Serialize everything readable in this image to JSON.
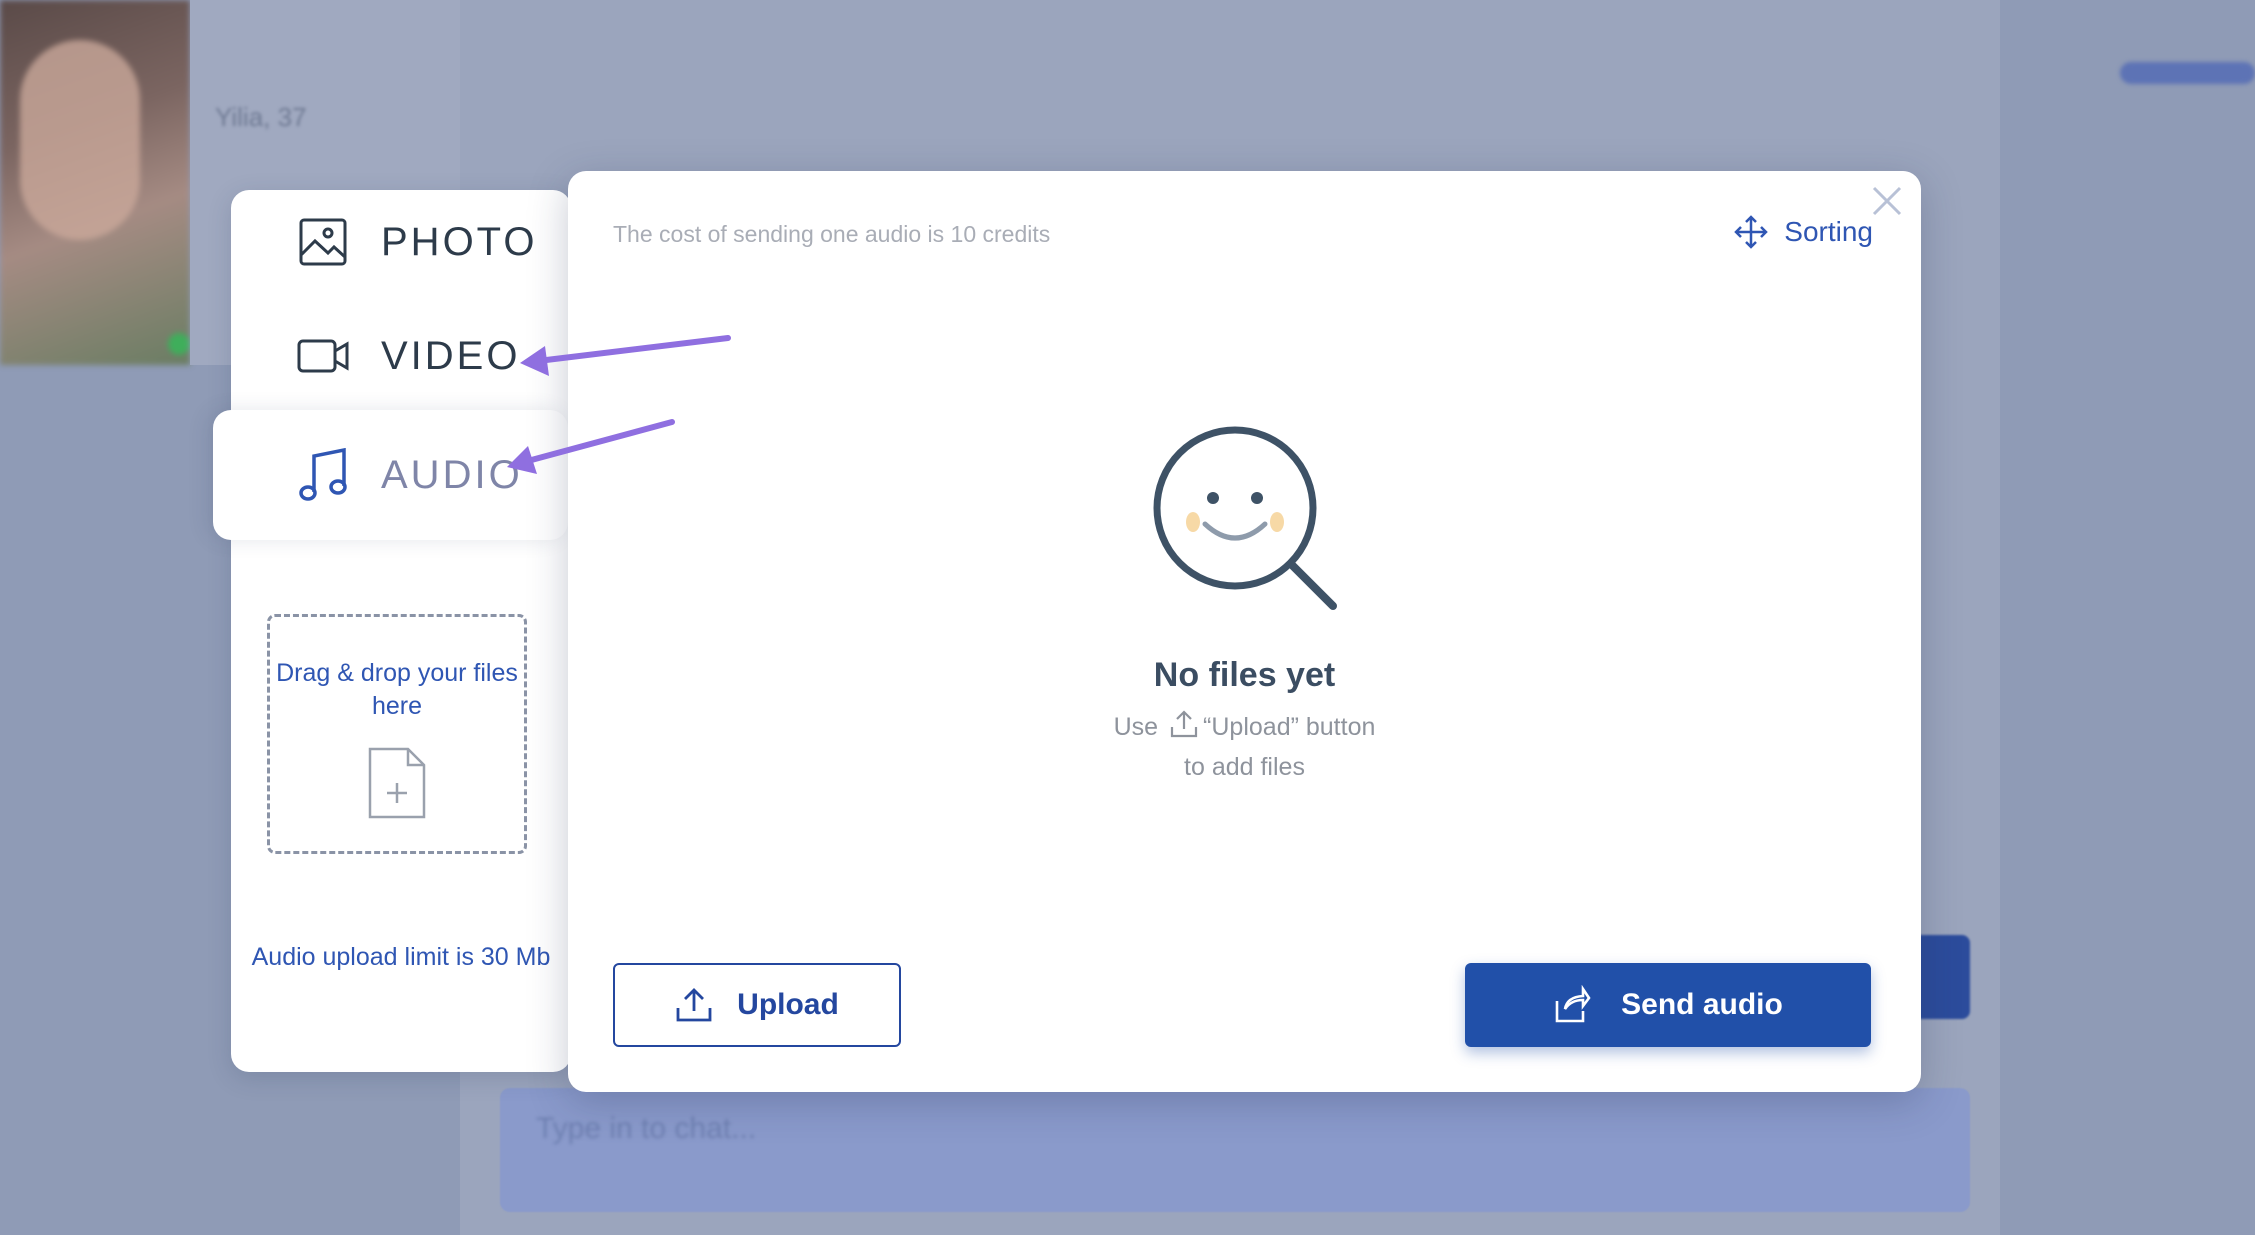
{
  "background": {
    "profile_name": "Yilia, 37",
    "chat_placeholder": "Type in to chat..."
  },
  "tabs": [
    {
      "label": "PHOTO",
      "icon": "image-icon"
    },
    {
      "label": "VIDEO",
      "icon": "video-camera-icon"
    },
    {
      "label": "AUDIO",
      "icon": "music-note-icon",
      "active": true
    }
  ],
  "dropzone": {
    "text": "Drag & drop your files here",
    "icon": "file-add-icon"
  },
  "upload_limit": "Audio upload limit is 30 Mb",
  "modal": {
    "cost_text": "The cost of sending one audio is 10 credits",
    "sorting_label": "Sorting",
    "empty_title": "No files yet",
    "empty_hint_prefix": "Use",
    "empty_hint_suffix": "“Upload” button",
    "empty_hint_line2": "to add files",
    "upload_label": "Upload",
    "send_label": "Send audio"
  },
  "colors": {
    "accent": "#2150a9",
    "link": "#2f56b3",
    "annotation_arrow": "#8f6fe0",
    "overlay": "#8f9bb6"
  }
}
